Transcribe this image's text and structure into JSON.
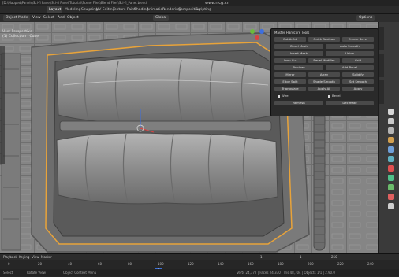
{
  "titlebar": {
    "path": "[D:\\Mapped\\Panels\\Sci-fi Panel\\Sci-fi Panel Tutorial\\Scene Files\\Blend Files\\Sci-fi_Panel.blend]",
    "watermark": "www.rrcg.cn"
  },
  "menu": {
    "items": [
      "Layout",
      "Modeling",
      "Sculpting",
      "UV Editing",
      "Texture Paint",
      "Shading",
      "Animation",
      "Rendering",
      "Compositing",
      "Scripting"
    ],
    "active_index": 0
  },
  "header": {
    "mode": "Object Mode",
    "view": "View",
    "select": "Select",
    "add": "Add",
    "object": "Object",
    "orientation": "Global",
    "options": "Options"
  },
  "viewport": {
    "view_name": "User Perspective",
    "collection": "(1) Collection | Cube"
  },
  "panel": {
    "title": "Master Hardcore Tools",
    "buttons": [
      [
        "Cut-A-Cut",
        "Quick Boolean",
        "Create Bevel"
      ],
      [
        "Bevel Mesh",
        "Auto Smooth"
      ],
      [
        "Insert Mesh",
        "Union"
      ],
      [
        "Loop Cut",
        "Bevel Modifier",
        "Grid"
      ],
      [
        "Boolean",
        "Add Bevel"
      ],
      [
        "Mirror",
        "Array",
        "Solidify"
      ],
      [
        "Edge Split",
        "Shade Smooth",
        "Set Smooth"
      ],
      [
        "Triangulate",
        "Apply All",
        "Apply"
      ],
      [
        "Remesh",
        "Decimate"
      ]
    ],
    "checks": [
      "Wire",
      "Bevel"
    ]
  },
  "timeline": {
    "labels": [
      "Playback",
      "Keying",
      "View",
      "Marker"
    ],
    "start": "1",
    "end": "250",
    "current": "1",
    "frames": [
      "0",
      "20",
      "40",
      "60",
      "80",
      "100",
      "120",
      "140",
      "160",
      "180",
      "200",
      "220",
      "240"
    ]
  },
  "statusbar": {
    "left": "Select",
    "mid": "Rotate View",
    "right": "Object Context Menu",
    "version": "Verts 24,372 | Faces 24,370 | Tris 48,704 | Objects 1/1 | 2.90.0"
  },
  "colors": {
    "viewport": "#8a8a8a",
    "accent": "#3b6fd6",
    "selection_outline": "#e8a33a"
  }
}
